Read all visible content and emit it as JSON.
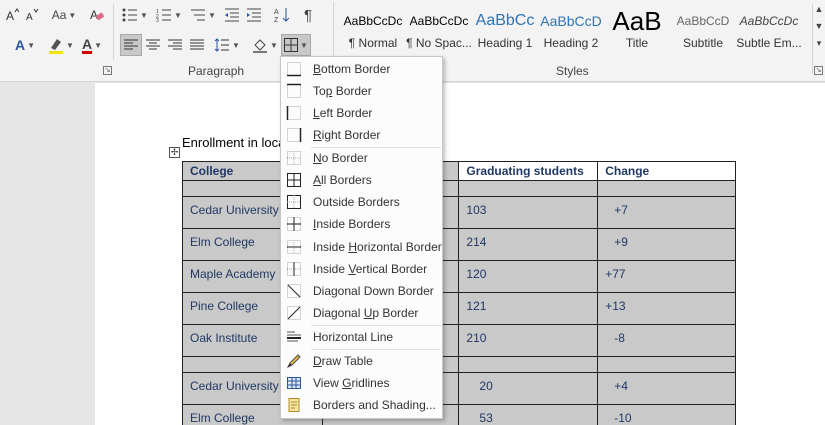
{
  "ribbon": {
    "font_row2": {
      "change_case_label": "Aa",
      "text_effects_label": "A",
      "font_color_label": "A"
    },
    "paragraph_group_label": "Paragraph",
    "styles_group_label": "Styles",
    "styles": [
      {
        "sample": "AaBbCcDc",
        "name": "¶ Normal"
      },
      {
        "sample": "AaBbCcDc",
        "name": "¶ No Spac..."
      },
      {
        "sample": "AaBbCc",
        "name": "Heading 1"
      },
      {
        "sample": "AaBbCcD",
        "name": "Heading 2"
      },
      {
        "sample": "AaB",
        "name": "Title"
      },
      {
        "sample": "AaBbCcD",
        "name": "Subtitle"
      },
      {
        "sample": "AaBbCcDc",
        "name": "Subtle Em..."
      }
    ]
  },
  "document": {
    "paragraph_text": "Enrollment in loca",
    "table": {
      "headers": [
        "College",
        "",
        "Graduating students",
        "Change"
      ],
      "rows": [
        [
          "",
          "",
          "",
          ""
        ],
        [
          "Cedar University",
          "",
          "103",
          "+7"
        ],
        [
          "Elm College",
          "",
          "214",
          "+9"
        ],
        [
          "Maple Academy",
          "",
          "120",
          "+77"
        ],
        [
          "Pine College",
          "",
          "121",
          "+13"
        ],
        [
          "Oak Institute",
          "",
          "210",
          "-8"
        ],
        [
          "",
          "",
          "",
          ""
        ],
        [
          "Cedar University",
          "",
          "20",
          "+4"
        ],
        [
          "Elm College",
          "",
          "53",
          "-10"
        ]
      ]
    }
  },
  "borders_menu": {
    "items": [
      {
        "label": "Bottom Border",
        "icon": "bottom-border-icon"
      },
      {
        "label": "Top Border",
        "icon": "top-border-icon"
      },
      {
        "label": "Left Border",
        "icon": "left-border-icon"
      },
      {
        "label": "Right Border",
        "icon": "right-border-icon"
      },
      {
        "label": "No Border",
        "icon": "no-border-icon"
      },
      {
        "label": "All Borders",
        "icon": "all-borders-icon"
      },
      {
        "label": "Outside Borders",
        "icon": "outside-borders-icon"
      },
      {
        "label": "Inside Borders",
        "icon": "inside-borders-icon"
      },
      {
        "label": "Inside Horizontal Border",
        "icon": "inside-horizontal-border-icon"
      },
      {
        "label": "Inside Vertical Border",
        "icon": "inside-vertical-border-icon"
      },
      {
        "label": "Diagonal Down Border",
        "icon": "diagonal-down-border-icon"
      },
      {
        "label": "Diagonal Up Border",
        "icon": "diagonal-up-border-icon"
      },
      {
        "label": "Horizontal Line",
        "icon": "horizontal-line-icon"
      },
      {
        "label": "Draw Table",
        "icon": "draw-table-icon"
      },
      {
        "label": "View Gridlines",
        "icon": "view-gridlines-icon"
      },
      {
        "label": "Borders and Shading...",
        "icon": "borders-shading-icon"
      }
    ]
  },
  "colors": {
    "highlight": "#f2e600",
    "font_color": "#d40000",
    "table_text": "#1f3864",
    "selection": "#c9c9c9"
  }
}
